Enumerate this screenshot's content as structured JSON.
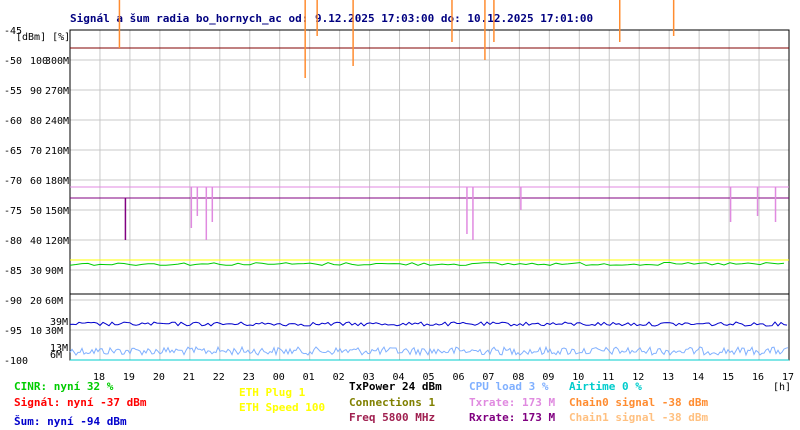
{
  "chart_data": {
    "type": "line",
    "title": "Signál a šum radia bo_hornych_ac od: 9.12.2025 17:03:00 do: 10.12.2025 17:01:00",
    "ylabel": "[dBm] [%]",
    "xlabel": "[h]",
    "y_dbm_range": [
      -100,
      -45
    ],
    "y_dbm_ticks": [
      "-45",
      "-50",
      "-55",
      "-60",
      "-65",
      "-70",
      "-75",
      "-80",
      "-85",
      "-90",
      "-95",
      "-100"
    ],
    "y_pct_ticks": [
      "100",
      "90",
      "80",
      "70",
      "60",
      "50",
      "40",
      "30",
      "20",
      "10"
    ],
    "y_rate_ticks": [
      "300M",
      "270M",
      "240M",
      "210M",
      "180M",
      "150M",
      "120M",
      "90M",
      "60M",
      "30M"
    ],
    "x_ticks": [
      "18",
      "19",
      "20",
      "21",
      "22",
      "23",
      "00",
      "01",
      "02",
      "03",
      "04",
      "05",
      "06",
      "07",
      "08",
      "09",
      "10",
      "11",
      "12",
      "13",
      "14",
      "15",
      "16",
      "17"
    ],
    "inline_labels": [
      {
        "text": "39M",
        "color": "#e08ae0"
      },
      {
        "text": "13M",
        "color": "#e08ae0"
      },
      {
        "text": "6M",
        "color": "#8000c0"
      }
    ],
    "series": [
      {
        "name": "Signál",
        "color": "#800080",
        "baseline": -73,
        "dips": [
          {
            "x": 18.7,
            "y": -80
          }
        ]
      },
      {
        "name": "Šum",
        "color": "#0000cc",
        "baseline": -94
      },
      {
        "name": "CINR",
        "color": "#00cc00",
        "baseline_pct": 32
      },
      {
        "name": "Txrate",
        "color": "#e08ae0",
        "baseline_mbps": 173,
        "dips": [
          {
            "x": 20.9,
            "y": -78
          },
          {
            "x": 21.1,
            "y": -76
          },
          {
            "x": 21.4,
            "y": -80
          },
          {
            "x": 21.6,
            "y": -77
          },
          {
            "x": 6.1,
            "y": -79
          },
          {
            "x": 6.3,
            "y": -80
          },
          {
            "x": 7.9,
            "y": -75
          },
          {
            "x": 14.9,
            "y": -77
          },
          {
            "x": 15.8,
            "y": -76
          },
          {
            "x": 16.4,
            "y": -77
          }
        ]
      },
      {
        "name": "Chain0 signal",
        "color": "#ff8c30",
        "baseline": -37,
        "dips": [
          {
            "x": 18.5,
            "y": -48
          },
          {
            "x": 0.7,
            "y": -53
          },
          {
            "x": 1.1,
            "y": -46
          },
          {
            "x": 2.3,
            "y": -51
          },
          {
            "x": 5.6,
            "y": -47
          },
          {
            "x": 6.7,
            "y": -50
          },
          {
            "x": 7.0,
            "y": -47
          },
          {
            "x": 11.2,
            "y": -47
          },
          {
            "x": 13.0,
            "y": -46
          }
        ]
      },
      {
        "name": "Chain1 signal",
        "color": "#ffc080",
        "baseline": -38
      },
      {
        "name": "CPU load",
        "color": "#80b0ff",
        "baseline_pct": 3
      },
      {
        "name": "ETH Speed",
        "color": "#ffff00",
        "baseline_mbps": 100
      },
      {
        "name": "Airtime",
        "color": "#00cccc",
        "baseline_pct": 0
      }
    ]
  },
  "legend": {
    "cinr": {
      "text": "CINR: nyní 32 %",
      "color": "#00cc00"
    },
    "signal": {
      "text": "Signál: nyní -37 dBm",
      "color": "#ff0000"
    },
    "noise": {
      "text": "Šum: nyní -94 dBm",
      "color": "#0000cc"
    },
    "eth_plug": {
      "text": "ETH Plug 1",
      "color": "#ffff00"
    },
    "eth_speed": {
      "text": "ETH Speed 100",
      "color": "#ffff00"
    },
    "txpower": {
      "text": "TxPower 24 dBm",
      "color": "#000000"
    },
    "connections": {
      "text": "Connections 1",
      "color": "#808000"
    },
    "freq": {
      "text": "Freq 5800 MHz",
      "color": "#a02050"
    },
    "cpu": {
      "text": "CPU load 3 %",
      "color": "#80b0ff"
    },
    "txrate": {
      "text": "Txrate: 173 M",
      "color": "#e08ae0"
    },
    "rxrate": {
      "text": "Rxrate: 173 M",
      "color": "#800080"
    },
    "airtime": {
      "text": "Airtime 0 %",
      "color": "#00cccc"
    },
    "chain0": {
      "text": "Chain0 signal -38 dBm",
      "color": "#ff8c30"
    },
    "chain1": {
      "text": "Chain1 signal -38 dBm",
      "color": "#ffc080"
    }
  }
}
